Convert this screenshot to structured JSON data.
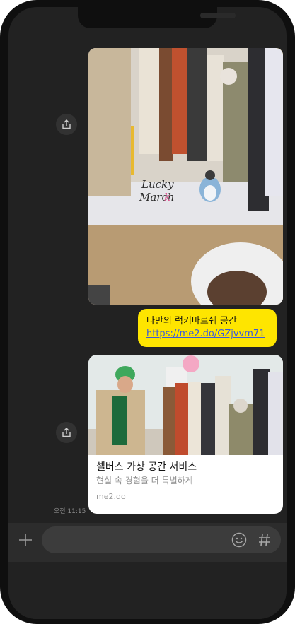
{
  "chat": {
    "photo": {
      "logo_line1": "Lucky",
      "logo_line2": "March"
    },
    "bubble": {
      "text": "나만의 럭키마르쉐 공간",
      "link": "https://me2.do/GZjvvm71"
    },
    "card": {
      "title": "셀버스 가상 공간 서비스",
      "description": "현실 속 경험을 더 특별하게",
      "domain": "me2.do"
    },
    "timestamp": "오전 11:15"
  },
  "input_bar": {
    "placeholder": "",
    "icons": [
      "plus-icon",
      "emoji-icon",
      "hash-icon"
    ]
  },
  "colors": {
    "background": "#222222",
    "bubble": "#FEE500",
    "link": "#3b5bdb",
    "input_field": "#3c3c3c"
  }
}
